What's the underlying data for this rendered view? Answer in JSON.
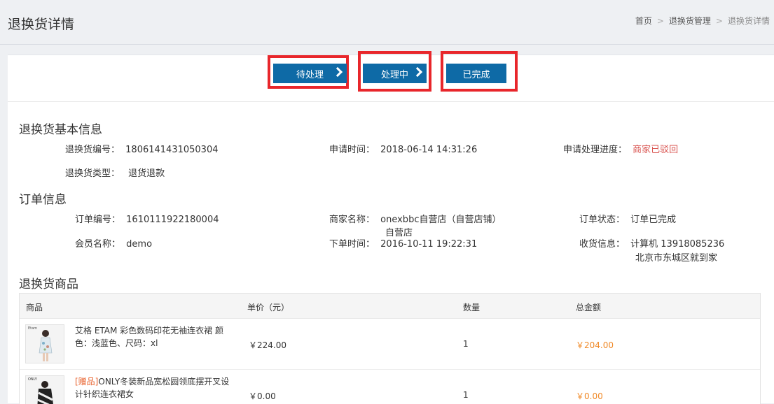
{
  "header": {
    "title": "退换货详情",
    "breadcrumb": [
      "首页",
      "退换货管理",
      "退换货详情"
    ],
    "breadcrumb_sep": ">"
  },
  "steps": [
    {
      "label": "待处理"
    },
    {
      "label": "处理中"
    },
    {
      "label": "已完成"
    }
  ],
  "basic_info": {
    "title": "退换货基本信息",
    "return_no_label": "退换货编号：",
    "return_no": "1806141431050304",
    "apply_time_label": "申请时间：",
    "apply_time": "2018-06-14 14:31:26",
    "progress_label": "申请处理进度：",
    "progress": "商家已驳回",
    "type_label": "退换货类型：",
    "type": "退货退款"
  },
  "order_info": {
    "title": "订单信息",
    "order_no_label": "订单编号：",
    "order_no": "1610111922180004",
    "merchant_label": "商家名称：",
    "merchant_line1": "onexbbc自营店（自营店铺）",
    "merchant_line2": "自营店",
    "status_label": "订单状态：",
    "status": "订单已完成",
    "member_label": "会员名称：",
    "member": "demo",
    "order_time_label": "下单时间：",
    "order_time": "2016-10-11 19:22:31",
    "receiver_label": "收货信息：",
    "receiver_line1": "计算机 13918085236",
    "receiver_line2": "北京市东城区就到家"
  },
  "goods": {
    "title": "退换货商品",
    "columns": [
      "商品",
      "单价（元）",
      "数量",
      "总金额"
    ],
    "rows": [
      {
        "gift_tag": "",
        "name": "艾格 ETAM 彩色数码印花无袖连衣裙 颜色：浅蓝色、尺码：xl",
        "price": "￥224.00",
        "qty": "1",
        "total": "￥204.00",
        "thumb_brand": "Etam"
      },
      {
        "gift_tag": "[赠品]",
        "name": "ONLY冬装新品宽松圆领底摆开叉设计针织连衣裙女",
        "price": "￥0.00",
        "qty": "1",
        "total": "￥0.00",
        "thumb_brand": "ONLY"
      }
    ]
  },
  "colors": {
    "step_blue": "#0e6aa6",
    "highlight_red": "#e8262b",
    "status_red": "#d9534f",
    "amount_orange": "#f08a28"
  }
}
